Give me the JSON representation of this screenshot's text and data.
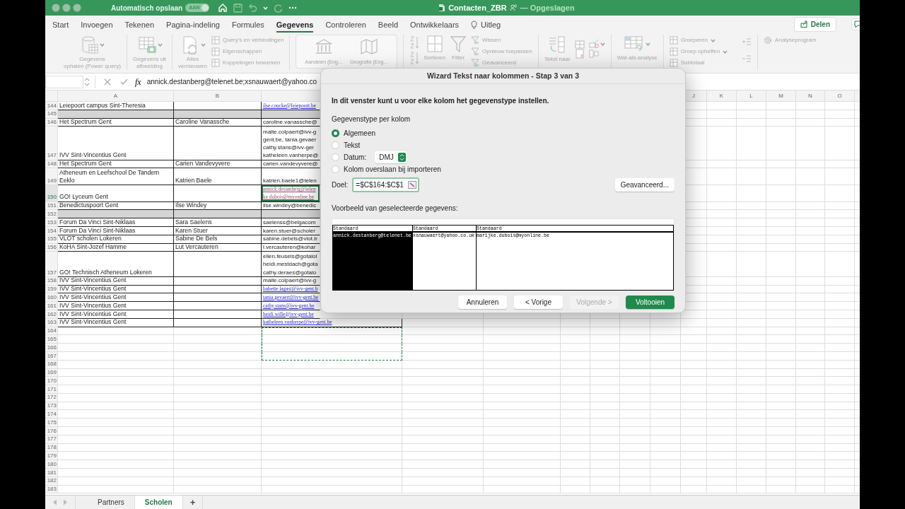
{
  "window": {
    "autosave_label": "Automatisch opslaan",
    "autosave_toggle": {
      "label": "AAN",
      "on": true
    },
    "title": "Contacten_ZBR",
    "save_status": "— Opgeslagen"
  },
  "ribbon_tabs": [
    {
      "label": "Start",
      "selected": false,
      "kind": "tab"
    },
    {
      "label": "Invoegen",
      "selected": false,
      "kind": "tab"
    },
    {
      "label": "Tekenen",
      "selected": false,
      "kind": "tab"
    },
    {
      "label": "Pagina-indeling",
      "selected": false,
      "kind": "tab"
    },
    {
      "label": "Formules",
      "selected": false,
      "kind": "tab"
    },
    {
      "label": "Gegevens",
      "selected": true,
      "kind": "tab"
    },
    {
      "label": "Controleren",
      "selected": false,
      "kind": "tab"
    },
    {
      "label": "Beeld",
      "selected": false,
      "kind": "tab"
    },
    {
      "label": "Ontwikkelaars",
      "selected": false,
      "kind": "tab"
    },
    {
      "label": "Uitleg",
      "selected": false,
      "kind": "help"
    }
  ],
  "share_button": "Delen",
  "ribbon": {
    "disabled": true,
    "groups": [
      {
        "items": [
          {
            "kind": "large",
            "lines": [
              "Gegevens",
              "ophalen (Power query)"
            ],
            "menu": true
          }
        ]
      },
      {
        "items": [
          {
            "kind": "large",
            "lines": [
              "Gegevens uit",
              "afbeelding"
            ],
            "menu": true
          }
        ]
      },
      {
        "items": [
          {
            "kind": "large",
            "lines": [
              "Alles",
              "vernieuwen"
            ],
            "menu": true
          },
          {
            "kind": "small",
            "lines": [
              "Query's en verbindingen"
            ],
            "menu": false
          },
          {
            "kind": "small",
            "lines": [
              "Eigenschappen"
            ],
            "menu": false
          },
          {
            "kind": "small",
            "lines": [
              "Koppelingen bewerken"
            ],
            "menu": false
          }
        ]
      },
      {
        "items": [
          {
            "kind": "gallery",
            "lines": [
              "Aandelen (Eng…"
            ],
            "menu": false
          },
          {
            "kind": "gallery",
            "lines": [
              "Geografie (Eng…"
            ],
            "menu": false
          }
        ]
      },
      {
        "items": [
          {
            "kind": "large",
            "lines": [
              "Sorteren"
            ],
            "menu": false
          },
          {
            "kind": "large",
            "lines": [
              "Filter"
            ],
            "menu": false
          },
          {
            "kind": "small",
            "lines": [
              "Wissen"
            ],
            "menu": false
          },
          {
            "kind": "small",
            "lines": [
              "Opnieuw toepassen"
            ],
            "menu": false
          },
          {
            "kind": "small",
            "lines": [
              "Geavanceerd"
            ],
            "menu": false
          }
        ]
      },
      {
        "items": [
          {
            "kind": "large",
            "lines": [
              "Tekst naar"
            ],
            "menu": false
          }
        ]
      },
      {
        "items": [
          {
            "kind": "large",
            "lines": [
              "Wat-als-analyse"
            ],
            "menu": true
          }
        ]
      },
      {
        "items": [
          {
            "kind": "small",
            "lines": [
              "Groeperen"
            ],
            "menu": true
          },
          {
            "kind": "small",
            "lines": [
              "Groep opheffen"
            ],
            "menu": true
          },
          {
            "kind": "small",
            "lines": [
              "Subtotaal"
            ],
            "menu": false
          }
        ]
      },
      {
        "items": [
          {
            "kind": "small",
            "lines": [
              "Analyseprogram"
            ],
            "menu": false
          }
        ]
      }
    ]
  },
  "formula_bar": {
    "function_label": "fx",
    "formula": "annick.destanberg@telenet.be;xsnauwaert@yahoo.co"
  },
  "sheet": {
    "column_headers_left": [
      "A",
      "B"
    ],
    "column_headers_right": [
      "J",
      "K",
      "L",
      "M",
      "N",
      "O"
    ],
    "rows": [
      {
        "number": "144",
        "a": [
          "Leiepoort campus Sint-Theresia"
        ],
        "c": {
          "lines": [
            "ilse.coucke@leiepoort.be"
          ],
          "kind": "link"
        },
        "shaded": false,
        "bordered": true,
        "selected": false,
        "marquee": false
      },
      {
        "number": "145",
        "shaded": true,
        "bordered": true,
        "selected": false,
        "marquee": false
      },
      {
        "number": "146",
        "a": [
          "Het Spectrum Gent"
        ],
        "b": [
          "Caroline Vanassche"
        ],
        "c": {
          "lines": [
            "caroline.vanassche@"
          ],
          "kind": "plain"
        },
        "shaded": false,
        "bordered": true,
        "selected": false,
        "marquee": false
      },
      {
        "number": "147",
        "a": [
          "IVV Sint-Vincentius Gent"
        ],
        "c": {
          "lines": [
            "maite.colpaert@ivv-g",
            "gent.be, tania.gevaer",
            "cathy.stans@ivv-ger",
            "katheleen.vanherpe@"
          ],
          "kind": "plain"
        },
        "shaded": false,
        "bordered": true,
        "selected": false,
        "marquee": false
      },
      {
        "number": "148",
        "a": [
          "Het Spectrum Gent"
        ],
        "b": [
          "Carien Vandevyvere"
        ],
        "c": {
          "lines": [
            "carien.vandevyvere@"
          ],
          "kind": "plain"
        },
        "shaded": false,
        "bordered": true,
        "selected": false,
        "marquee": false
      },
      {
        "number": "149",
        "a": [
          "Atheneum en Leefschool De Tandem",
          "Eeklo"
        ],
        "b": [
          "Katrien Baele"
        ],
        "c": {
          "lines": [
            "katrien.baele1@telen"
          ],
          "kind": "plain"
        },
        "shaded": false,
        "bordered": true,
        "selected": false,
        "marquee": false
      },
      {
        "number": "150",
        "a": [
          "GO! Lyceum Gent"
        ],
        "c": {
          "lines": [
            "annick.destanberg@telen",
            "ke.dubois@myonline.be"
          ],
          "kind": "visited"
        },
        "shaded": false,
        "bordered": true,
        "selected": true,
        "marquee": false
      },
      {
        "number": "151",
        "a": [
          "Benedictuspoort Gent"
        ],
        "b": [
          "Ilse Windey"
        ],
        "c": {
          "lines": [
            "ilse.windey@benedic"
          ],
          "kind": "plain"
        },
        "shaded": false,
        "bordered": true,
        "selected": false,
        "marquee": false
      },
      {
        "number": "152",
        "shaded": true,
        "bordered": true,
        "selected": false,
        "marquee": false
      },
      {
        "number": "153",
        "a": [
          "Forum Da Vinci Sint-Niklaas"
        ],
        "b": [
          "Sara Saelens"
        ],
        "c": {
          "lines": [
            "saelenss@belgacom"
          ],
          "kind": "plain"
        },
        "shaded": false,
        "bordered": true,
        "selected": false,
        "marquee": false
      },
      {
        "number": "154",
        "a": [
          "Forum Da Vinci Sint-Niklaas"
        ],
        "b": [
          "Karen Stuer"
        ],
        "c": {
          "lines": [
            "karen.stuer@scholer"
          ],
          "kind": "plain"
        },
        "shaded": false,
        "bordered": true,
        "selected": false,
        "marquee": false
      },
      {
        "number": "155",
        "a": [
          "VLOT scholen Lokeren"
        ],
        "b": [
          "Sabine De Bels"
        ],
        "c": {
          "lines": [
            "sabine.debels@vlot.b"
          ],
          "kind": "plain"
        },
        "shaded": false,
        "bordered": true,
        "selected": false,
        "marquee": false
      },
      {
        "number": "156",
        "a": [
          "KoHA Sint-Jozef Hamme"
        ],
        "b": [
          "Lut Vercauteren"
        ],
        "c": {
          "lines": [
            "l.vercauteren@kohar"
          ],
          "kind": "plain"
        },
        "shaded": false,
        "bordered": true,
        "selected": false,
        "marquee": false
      },
      {
        "number": "157",
        "a": [
          "GO! Technisch Atheneum Lokeren"
        ],
        "c": {
          "lines": [
            "ellen.feusels@gotalol",
            "heidi.mestdach@gota",
            "cathy.deraes@gotalo"
          ],
          "kind": "plain"
        },
        "shaded": false,
        "bordered": true,
        "selected": false,
        "marquee": false
      },
      {
        "number": "158",
        "a": [
          "IVV Sint-Vincentius Gent"
        ],
        "c": {
          "lines": [
            "maite.colpaert@ivv-g"
          ],
          "kind": "plain"
        },
        "shaded": false,
        "bordered": true,
        "selected": false,
        "marquee": false
      },
      {
        "number": "159",
        "a": [
          "IVV Sint-Vincentius Gent"
        ],
        "c": {
          "lines": [
            "babette.lagast@ivv-gent.b"
          ],
          "kind": "link"
        },
        "shaded": false,
        "bordered": true,
        "selected": false,
        "marquee": false
      },
      {
        "number": "160",
        "a": [
          "IVV Sint-Vincentius Gent"
        ],
        "c": {
          "lines": [
            "tania.gevaert@ivv-gent.be"
          ],
          "kind": "link"
        },
        "shaded": false,
        "bordered": true,
        "selected": false,
        "marquee": false
      },
      {
        "number": "161",
        "a": [
          "IVV Sint-Vincentius Gent"
        ],
        "c": {
          "lines": [
            "cathy.stans@ivv-gent.be"
          ],
          "kind": "link"
        },
        "shaded": false,
        "bordered": true,
        "selected": false,
        "marquee": false
      },
      {
        "number": "162",
        "a": [
          "IVV Sint-Vincentius Gent"
        ],
        "c": {
          "lines": [
            "heidi.wille@ivv-gent.be"
          ],
          "kind": "link"
        },
        "shaded": false,
        "bordered": true,
        "selected": false,
        "marquee": false
      },
      {
        "number": "163",
        "a": [
          "IVV Sint-Vincentius Gent"
        ],
        "c": {
          "lines": [
            "katheleen.vanherpe@ivv-gent.be"
          ],
          "kind": "link"
        },
        "shaded": false,
        "bordered": true,
        "selected": false,
        "marquee": false
      },
      {
        "number": "164",
        "shaded": false,
        "bordered": false,
        "selected": false,
        "marquee": true
      },
      {
        "number": "165",
        "shaded": false,
        "bordered": false,
        "selected": false,
        "marquee": true
      },
      {
        "number": "166",
        "shaded": false,
        "bordered": false,
        "selected": false,
        "marquee": true
      },
      {
        "number": "167",
        "shaded": false,
        "bordered": false,
        "selected": false,
        "marquee": true
      },
      {
        "number": "168",
        "shaded": false,
        "bordered": false,
        "selected": false,
        "marquee": false
      },
      {
        "number": "169",
        "shaded": false,
        "bordered": false,
        "selected": false,
        "marquee": false
      },
      {
        "number": "170",
        "shaded": false,
        "bordered": false,
        "selected": false,
        "marquee": false
      },
      {
        "number": "171",
        "shaded": false,
        "bordered": false,
        "selected": false,
        "marquee": false
      },
      {
        "number": "172",
        "shaded": false,
        "bordered": false,
        "selected": false,
        "marquee": false
      },
      {
        "number": "173",
        "shaded": false,
        "bordered": false,
        "selected": false,
        "marquee": false
      },
      {
        "number": "174",
        "shaded": false,
        "bordered": false,
        "selected": false,
        "marquee": false
      },
      {
        "number": "175",
        "shaded": false,
        "bordered": false,
        "selected": false,
        "marquee": false
      },
      {
        "number": "176",
        "shaded": false,
        "bordered": false,
        "selected": false,
        "marquee": false
      },
      {
        "number": "177",
        "shaded": false,
        "bordered": false,
        "selected": false,
        "marquee": false
      },
      {
        "number": "178",
        "shaded": false,
        "bordered": false,
        "selected": false,
        "marquee": false
      },
      {
        "number": "179",
        "shaded": false,
        "bordered": false,
        "selected": false,
        "marquee": false
      },
      {
        "number": "180",
        "shaded": false,
        "bordered": false,
        "selected": false,
        "marquee": false
      },
      {
        "number": "181",
        "shaded": false,
        "bordered": false,
        "selected": false,
        "marquee": false
      },
      {
        "number": "182",
        "shaded": false,
        "bordered": false,
        "selected": false,
        "marquee": false
      },
      {
        "number": "183",
        "shaded": false,
        "bordered": false,
        "selected": false,
        "marquee": false
      }
    ]
  },
  "sheet_tabs": [
    {
      "label": "Partners",
      "selected": false
    },
    {
      "label": "Scholen",
      "selected": true
    }
  ],
  "add_sheet": "+",
  "dialog": {
    "title": "Wizard Tekst naar kolommen - Stap 3 van 3",
    "instruction": "In dit venster kunt u voor elke kolom het gegevenstype instellen.",
    "group_label": "Gegevenstype per kolom",
    "options": [
      {
        "label": "Algemeen",
        "selected": true,
        "kind": "plain"
      },
      {
        "label": "Tekst",
        "selected": false,
        "kind": "plain"
      },
      {
        "label": "Datum:",
        "selected": false,
        "kind": "date",
        "date_format": "DMJ"
      },
      {
        "label": "Kolom overslaan bij importeren",
        "selected": false,
        "kind": "plain"
      }
    ],
    "destination_label": "Doel:",
    "destination_value": "=$C$164:$C$1",
    "advanced_button": "Geavanceerd...",
    "preview_label": "Voorbeeld van geselecteerde gegevens:",
    "preview_columns": [
      {
        "header": "Standaard",
        "value": "annick.destanberg@telenet.be",
        "selected": true
      },
      {
        "header": "Standaard",
        "value": "xsnauwaert@yahoo.co.uk",
        "selected": false
      },
      {
        "header": "Standaard",
        "value": "marijke.dubois@myonline.be",
        "selected": false
      }
    ],
    "buttons": [
      {
        "label": "Annuleren",
        "kind": "normal",
        "disabled": false
      },
      {
        "label": "< Vorige",
        "kind": "normal",
        "disabled": false
      },
      {
        "label": "Volgende >",
        "kind": "normal",
        "disabled": true
      },
      {
        "label": "Voltooien",
        "kind": "default",
        "disabled": false
      }
    ]
  }
}
